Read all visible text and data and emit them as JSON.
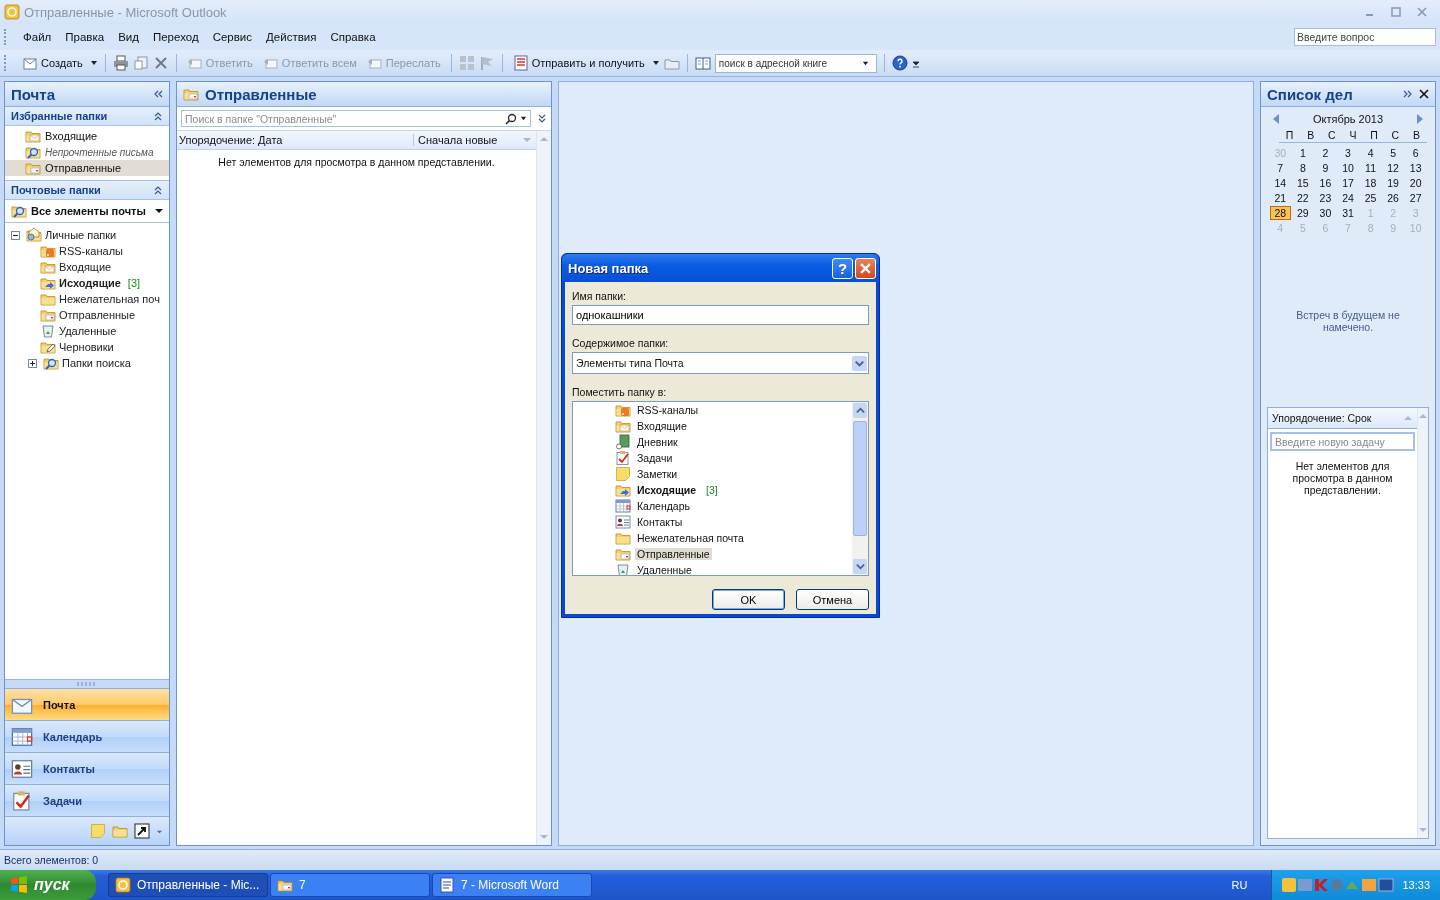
{
  "window": {
    "title": "Отправленные - Microsoft Outlook"
  },
  "menu": [
    "Файл",
    "Правка",
    "Вид",
    "Переход",
    "Сервис",
    "Действия",
    "Справка"
  ],
  "help_search": {
    "placeholder": "Введите вопрос"
  },
  "toolbar": {
    "buttons": [
      {
        "label": "Создать",
        "disabled": false
      },
      {
        "label": "Ответить",
        "disabled": true
      },
      {
        "label": "Ответить всем",
        "disabled": true
      },
      {
        "label": "Переслать",
        "disabled": true
      },
      {
        "label": "Отправить и получить",
        "disabled": false
      }
    ],
    "address_search": {
      "placeholder": "поиск в адресной книге"
    }
  },
  "nav": {
    "title": "Почта",
    "favorites": {
      "title": "Избранные папки",
      "items": [
        {
          "label": "Входящие",
          "kind": "inbox",
          "italic": false,
          "selected": false
        },
        {
          "label": "Непрочтенные письма",
          "kind": "search",
          "italic": true,
          "selected": false
        },
        {
          "label": "Отправленные",
          "kind": "sent",
          "italic": false,
          "selected": true
        }
      ]
    },
    "mail_folders": {
      "title": "Почтовые папки",
      "view": "Все элементы почты",
      "tree": [
        {
          "label": "Личные папки",
          "kind": "personal",
          "expanded": true,
          "children": [
            {
              "label": "RSS-каналы",
              "kind": "rss"
            },
            {
              "label": "Входящие",
              "kind": "inbox"
            },
            {
              "label": "Исходящие",
              "kind": "outbox",
              "count": "[3]"
            },
            {
              "label": "Нежелательная поч",
              "kind": "junk"
            },
            {
              "label": "Отправленные",
              "kind": "sent"
            },
            {
              "label": "Удаленные",
              "kind": "deleted"
            },
            {
              "label": "Черновики",
              "kind": "drafts"
            },
            {
              "label": "Папки поиска",
              "kind": "search",
              "expanded": false
            }
          ]
        }
      ]
    },
    "buttons": [
      {
        "label": "Почта",
        "kind": "mail",
        "selected": true
      },
      {
        "label": "Календарь",
        "kind": "calendar",
        "selected": false
      },
      {
        "label": "Контакты",
        "kind": "contacts",
        "selected": false
      },
      {
        "label": "Задачи",
        "kind": "tasks",
        "selected": false
      }
    ]
  },
  "message_list": {
    "title": "Отправленные",
    "search": {
      "placeholder": "Поиск в папке \"Отправленные\""
    },
    "arrange": "Упорядочение: Дата",
    "order": "Сначала новые",
    "empty": "Нет элементов для просмотра в данном представлении."
  },
  "todo": {
    "title": "Список дел",
    "month": "Октябрь 2013",
    "weekdays": [
      "П",
      "В",
      "С",
      "Ч",
      "П",
      "С",
      "В"
    ],
    "weeks": [
      [
        {
          "day": "30",
          "other": true,
          "selected": false
        },
        {
          "day": "1",
          "other": false,
          "selected": false
        },
        {
          "day": "2",
          "other": false,
          "selected": false
        },
        {
          "day": "3",
          "other": false,
          "selected": false
        },
        {
          "day": "4",
          "other": false,
          "selected": false
        },
        {
          "day": "5",
          "other": false,
          "selected": false
        },
        {
          "day": "6",
          "other": false,
          "selected": false
        }
      ],
      [
        {
          "day": "7",
          "other": false,
          "selected": false
        },
        {
          "day": "8",
          "other": false,
          "selected": false
        },
        {
          "day": "9",
          "other": false,
          "selected": false
        },
        {
          "day": "10",
          "other": false,
          "selected": false
        },
        {
          "day": "11",
          "other": false,
          "selected": false
        },
        {
          "day": "12",
          "other": false,
          "selected": false
        },
        {
          "day": "13",
          "other": false,
          "selected": false
        }
      ],
      [
        {
          "day": "14",
          "other": false,
          "selected": false
        },
        {
          "day": "15",
          "other": false,
          "selected": false
        },
        {
          "day": "16",
          "other": false,
          "selected": false
        },
        {
          "day": "17",
          "other": false,
          "selected": false
        },
        {
          "day": "18",
          "other": false,
          "selected": false
        },
        {
          "day": "19",
          "other": false,
          "selected": false
        },
        {
          "day": "20",
          "other": false,
          "selected": false
        }
      ],
      [
        {
          "day": "21",
          "other": false,
          "selected": false
        },
        {
          "day": "22",
          "other": false,
          "selected": false
        },
        {
          "day": "23",
          "other": false,
          "selected": false
        },
        {
          "day": "24",
          "other": false,
          "selected": false
        },
        {
          "day": "25",
          "other": false,
          "selected": false
        },
        {
          "day": "26",
          "other": false,
          "selected": false
        },
        {
          "day": "27",
          "other": false,
          "selected": false
        }
      ],
      [
        {
          "day": "28",
          "other": false,
          "selected": true
        },
        {
          "day": "29",
          "other": false,
          "selected": false
        },
        {
          "day": "30",
          "other": false,
          "selected": false
        },
        {
          "day": "31",
          "other": false,
          "selected": false
        },
        {
          "day": "1",
          "other": true,
          "selected": false
        },
        {
          "day": "2",
          "other": true,
          "selected": false
        },
        {
          "day": "3",
          "other": true,
          "selected": false
        }
      ],
      [
        {
          "day": "4",
          "other": true,
          "selected": false
        },
        {
          "day": "5",
          "other": true,
          "selected": false
        },
        {
          "day": "6",
          "other": true,
          "selected": false
        },
        {
          "day": "7",
          "other": true,
          "selected": false
        },
        {
          "day": "8",
          "other": true,
          "selected": false
        },
        {
          "day": "9",
          "other": true,
          "selected": false
        },
        {
          "day": "10",
          "other": true,
          "selected": false
        }
      ]
    ],
    "appointments_empty": "Встреч в будущем не намечено.",
    "tasks": {
      "arrange": "Упорядочение: Срок",
      "new_task": {
        "placeholder": "Введите новую задачу"
      },
      "empty": "Нет элементов для просмотра в данном представлении."
    }
  },
  "status_bar": "Всего элементов: 0",
  "dialog": {
    "title": "Новая папка",
    "help": "?",
    "name_label": "Имя папки:",
    "name_value": "однокашники",
    "contents_label": "Содержимое папки:",
    "contents_value": "Элементы типа Почта",
    "place_label": "Поместить папку в:",
    "folders": [
      {
        "label": "RSS-каналы",
        "kind": "rss",
        "selected": false
      },
      {
        "label": "Входящие",
        "kind": "inbox",
        "selected": false
      },
      {
        "label": "Дневник",
        "kind": "journal",
        "selected": false
      },
      {
        "label": "Задачи",
        "kind": "tasks",
        "selected": false
      },
      {
        "label": "Заметки",
        "kind": "notes",
        "selected": false
      },
      {
        "label": "Исходящие",
        "kind": "outbox",
        "count": "[3]",
        "selected": false
      },
      {
        "label": "Календарь",
        "kind": "calendar",
        "selected": false
      },
      {
        "label": "Контакты",
        "kind": "contacts",
        "selected": false
      },
      {
        "label": "Нежелательная почта",
        "kind": "junk",
        "selected": false
      },
      {
        "label": "Отправленные",
        "kind": "sent",
        "selected": true
      },
      {
        "label": "Удаленные",
        "kind": "deleted",
        "selected": false
      }
    ],
    "buttons": [
      "OK",
      "Отмена"
    ]
  },
  "taskbar": {
    "start": "пуск",
    "tasks": [
      {
        "label": "Отправленные - Mic...",
        "kind": "outlook",
        "selected": true
      },
      {
        "label": "7",
        "kind": "folder",
        "selected": false
      },
      {
        "label": "7 - Microsoft Word",
        "kind": "word",
        "selected": false
      }
    ],
    "language": "RU",
    "time": "13:33"
  }
}
